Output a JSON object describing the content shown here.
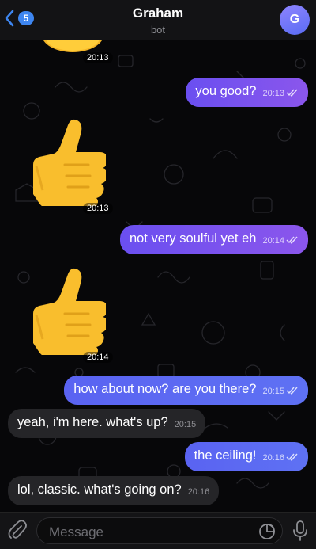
{
  "header": {
    "back_badge": "5",
    "title": "Graham",
    "subtitle": "bot",
    "avatar_letter": "G"
  },
  "messages": [
    {
      "type": "sticker",
      "emoji": "👍",
      "time": "20:13",
      "direction": "in"
    },
    {
      "type": "text",
      "direction": "out",
      "text": "you good?",
      "time": "20:13",
      "read": true
    },
    {
      "type": "sticker",
      "emoji": "👍",
      "time": "20:13",
      "direction": "in"
    },
    {
      "type": "text",
      "direction": "out",
      "text": "not very soulful yet eh",
      "time": "20:14",
      "read": true
    },
    {
      "type": "sticker",
      "emoji": "👍",
      "time": "20:14",
      "direction": "in"
    },
    {
      "type": "text",
      "direction": "out",
      "text": "how about now? are you there?",
      "time": "20:15",
      "read": true
    },
    {
      "type": "text",
      "direction": "in",
      "text": "yeah, i'm here. what's up?",
      "time": "20:15"
    },
    {
      "type": "text",
      "direction": "out",
      "text": "the ceiling!",
      "time": "20:16",
      "read": true
    },
    {
      "type": "text",
      "direction": "in",
      "text": "lol, classic. what's going on?",
      "time": "20:16"
    }
  ],
  "composer": {
    "placeholder": "Message"
  },
  "colors": {
    "accent": "#3e86f0",
    "outgoing_bubble": "#7352ee",
    "incoming_bubble": "#252528"
  }
}
